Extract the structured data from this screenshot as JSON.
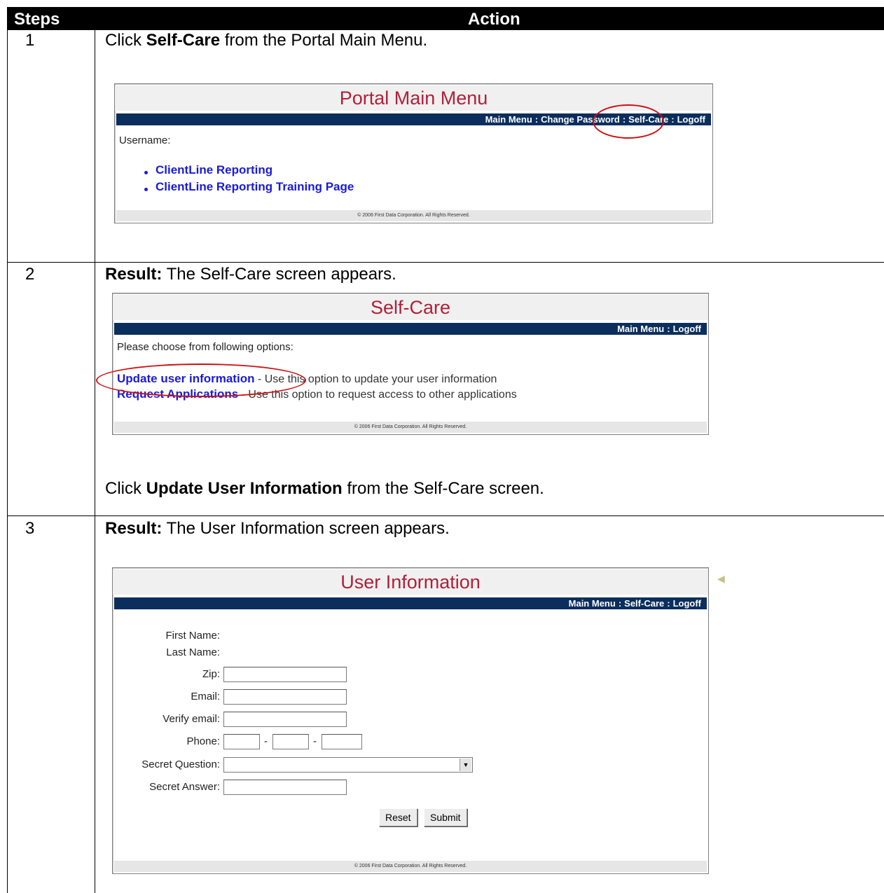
{
  "table": {
    "header_steps": "Steps",
    "header_action": "Action"
  },
  "step1": {
    "number": "1",
    "text_pre": "Click ",
    "text_bold": "Self-Care",
    "text_post": " from the Portal Main Menu.",
    "screen": {
      "title": "Portal Main Menu",
      "nav": [
        "Main Menu",
        "Change Password",
        "Self-Care",
        "Logoff"
      ],
      "username_label": "Username:",
      "links": [
        "ClientLine Reporting",
        "ClientLine Reporting Training Page"
      ],
      "footer": "© 2006 First Data Corporation. All Rights Reserved."
    }
  },
  "step2": {
    "number": "2",
    "result_bold": "Result:",
    "result_text": " The Self-Care screen appears.",
    "screen": {
      "title": "Self-Care",
      "nav": [
        "Main Menu",
        "Logoff"
      ],
      "prompt": "Please choose from following options:",
      "options": [
        {
          "label": "Update user information",
          "desc": " - Use this option to update your user information"
        },
        {
          "label": "Request Applications",
          "desc": " - Use this option to request access to other applications"
        }
      ],
      "footer": "© 2006 First Data Corporation. All Rights Reserved."
    },
    "instr_pre": "Click ",
    "instr_bold": "Update User Information",
    "instr_post": " from the Self-Care screen."
  },
  "step3": {
    "number": "3",
    "result_bold": "Result:",
    "result_text": " The User Information screen appears.",
    "screen": {
      "title": "User Information",
      "nav": [
        "Main Menu",
        "Self-Care",
        "Logoff"
      ],
      "labels": {
        "first_name": "First Name:",
        "last_name": "Last Name:",
        "zip": "Zip:",
        "email": "Email:",
        "verify_email": "Verify email:",
        "phone": "Phone:",
        "secret_question": "Secret Question:",
        "secret_answer": "Secret Answer:"
      },
      "phone_separator": "-",
      "buttons": {
        "reset": "Reset",
        "submit": "Submit"
      },
      "footer": "© 2006 First Data Corporation. All Rights Reserved."
    }
  },
  "colors": {
    "header_bg": "#000000",
    "title_red": "#b0203a",
    "nav_blue": "#0b2e5c",
    "link_blue": "#1a1ad8",
    "highlight_red": "#cc1111"
  }
}
